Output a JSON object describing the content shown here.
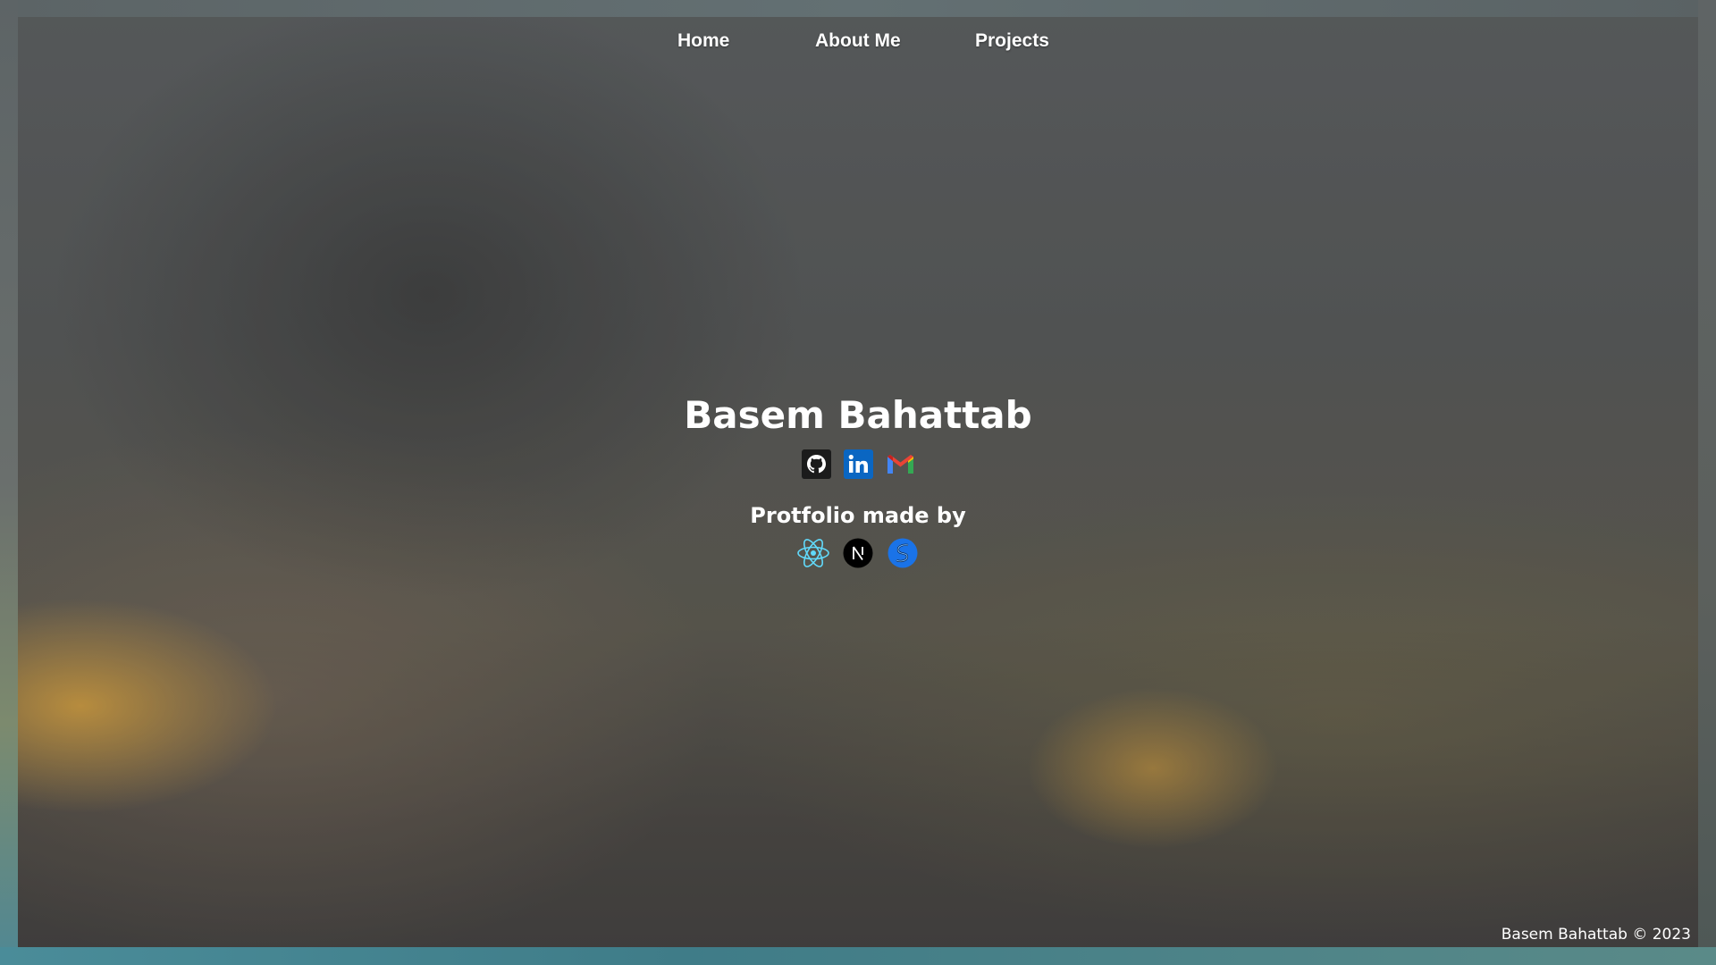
{
  "nav": {
    "items": [
      {
        "label": "Home"
      },
      {
        "label": "About Me"
      },
      {
        "label": "Projects"
      }
    ]
  },
  "hero": {
    "name": "Basem Bahattab",
    "social_icons": [
      "github-icon",
      "linkedin-icon",
      "gmail-icon"
    ],
    "made_by_label": "Protfolio made by",
    "tech_icons": [
      "react-icon",
      "nextjs-icon",
      "styled-icon"
    ]
  },
  "footer": {
    "text": "Basem Bahattab © 2023"
  },
  "colors": {
    "text": "#ffffff",
    "linkedin": "#0a66c2",
    "react": "#61dafb",
    "gmail_red": "#ea4335",
    "gmail_blue": "#4285f4",
    "gmail_green": "#34a853",
    "gmail_yellow": "#fbbc04",
    "tech_blue": "#1a73e8"
  }
}
